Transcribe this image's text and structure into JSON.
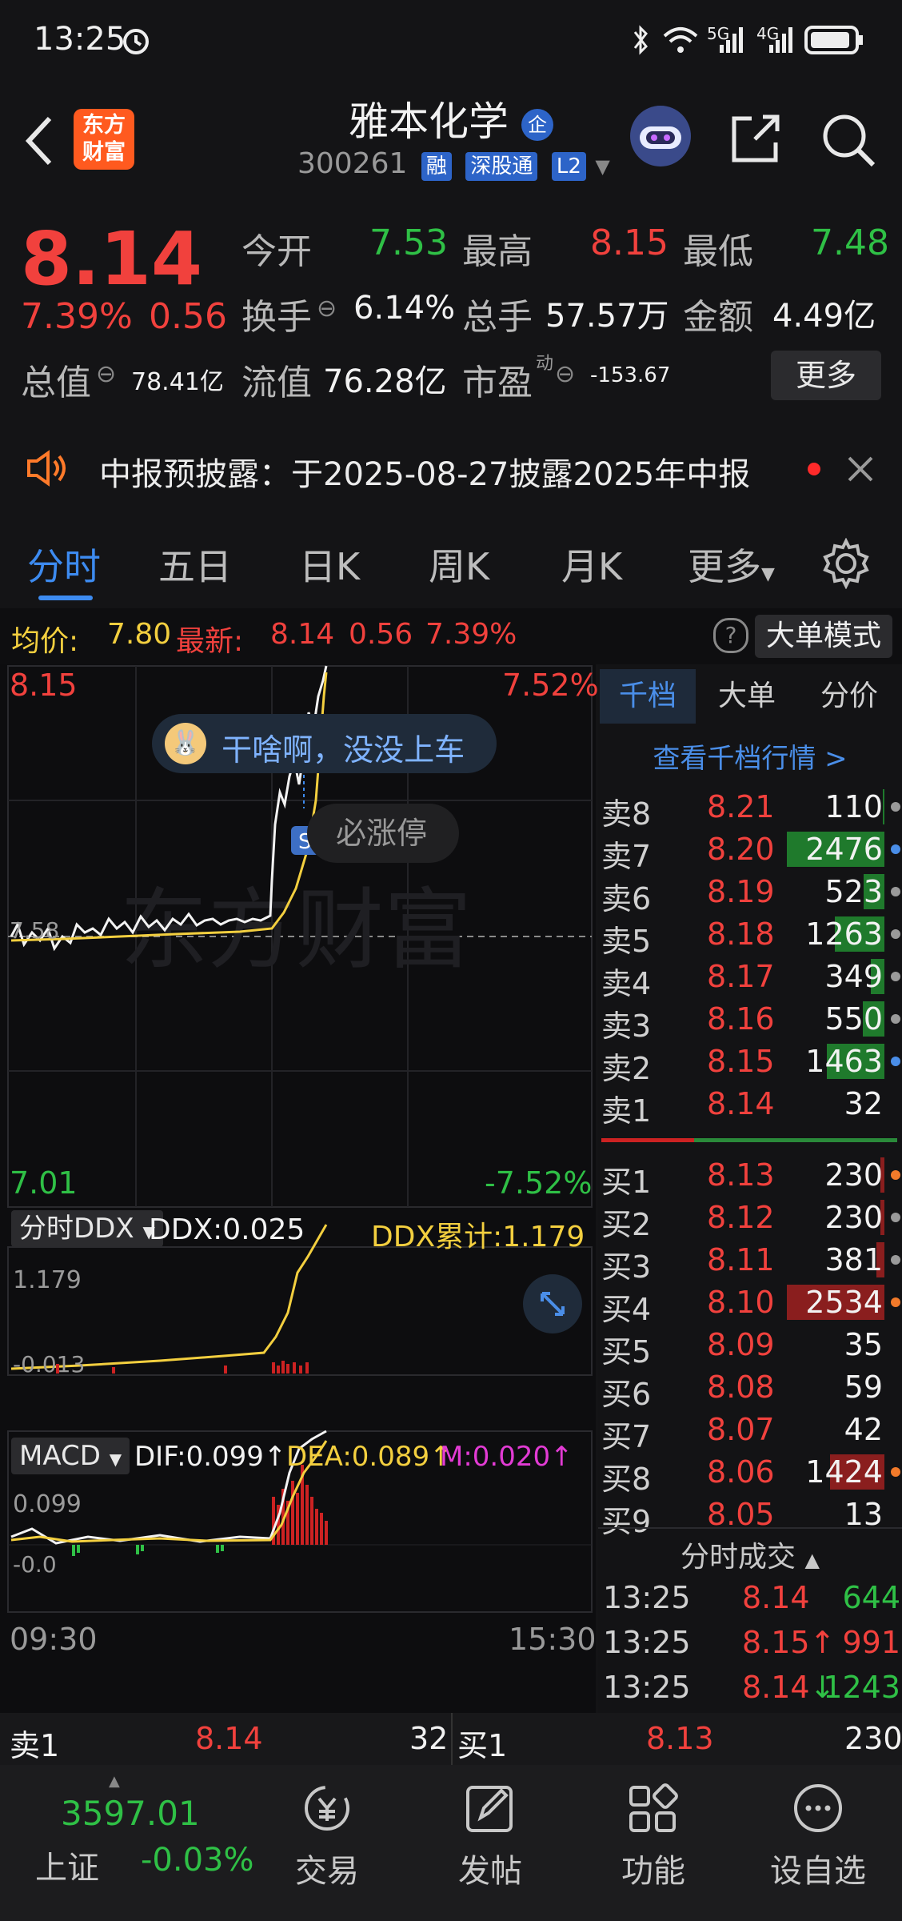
{
  "status_bar": {
    "time": "13:25",
    "signal_5g": "5G",
    "signal_4g": "4G"
  },
  "header": {
    "logo_line1": "东方",
    "logo_line2": "财富",
    "stock_name": "雅本化学",
    "name_badge": "企",
    "stock_code": "300261",
    "badges": [
      "融",
      "深股通",
      "L2"
    ]
  },
  "quote": {
    "price": "8.14",
    "change_pct": "7.39%",
    "change_abs": "0.56",
    "open_label": "今开",
    "open_value": "7.53",
    "high_label": "最高",
    "high_value": "8.15",
    "low_label": "最低",
    "low_value": "7.48",
    "turnover_label": "换手",
    "turnover_value": "6.14%",
    "volume_label": "总手",
    "volume_value": "57.57万",
    "amount_label": "金额",
    "amount_value": "4.49亿",
    "mktcap_label": "总值",
    "mktcap_value": "78.41亿",
    "float_label": "流值",
    "float_value": "76.28亿",
    "pe_label": "市盈",
    "pe_sup": "动",
    "pe_value": "-153.67",
    "more_button": "更多"
  },
  "notice": {
    "text": "中报预披露：于2025-08-27披露2025年中报"
  },
  "tabs": [
    "分时",
    "五日",
    "日K",
    "周K",
    "月K",
    "更多"
  ],
  "avg_bar": {
    "avg_label": "均价:",
    "avg_value": "7.80",
    "latest_label": "最新:",
    "latest_value": "8.14",
    "latest_change": "0.56",
    "latest_pct": "7.39%",
    "big_order_button": "大单模式"
  },
  "chart": {
    "price_high": "8.15",
    "pct_high": "7.52%",
    "price_low": "7.01",
    "pct_low": "-7.52%",
    "mid_price": "7.58",
    "bubble1": "干啥啊，没没上车",
    "bubble2": "必涨停",
    "watermark": "东方财富",
    "time_start": "09:30",
    "time_end": "15:30"
  },
  "ddx": {
    "selector": "分时DDX",
    "ddx_label": "DDX:0.025",
    "ddx_total": "DDX累计:1.179",
    "axis_top": "1.179",
    "axis_low": "-0.013"
  },
  "macd": {
    "selector": "MACD",
    "dif": "DIF:0.099",
    "dea": "DEA:0.089",
    "m": "M:0.020",
    "axis_top": "0.099",
    "axis_low": "-0.0"
  },
  "order_book": {
    "tabs": [
      "千档",
      "大单",
      "分价"
    ],
    "view_link": "查看千档行情 >",
    "asks": [
      {
        "label": "卖8",
        "price": "8.21",
        "vol": "110",
        "bar": 0.02,
        "dot": "#9a9a9a"
      },
      {
        "label": "卖7",
        "price": "8.20",
        "vol": "2476",
        "bar": 1.0,
        "dot": "#4a8ee8"
      },
      {
        "label": "卖6",
        "price": "8.19",
        "vol": "523",
        "bar": 0.21,
        "dot": "#9a9a9a"
      },
      {
        "label": "卖5",
        "price": "8.18",
        "vol": "1263",
        "bar": 0.51,
        "dot": "#9a9a9a"
      },
      {
        "label": "卖4",
        "price": "8.17",
        "vol": "349",
        "bar": 0.14,
        "dot": "#9a9a9a"
      },
      {
        "label": "卖3",
        "price": "8.16",
        "vol": "550",
        "bar": 0.22,
        "dot": "#9a9a9a"
      },
      {
        "label": "卖2",
        "price": "8.15",
        "vol": "1463",
        "bar": 0.59,
        "dot": "#4a8ee8"
      },
      {
        "label": "卖1",
        "price": "8.14",
        "vol": "32",
        "bar": 0.0,
        "dot": ""
      }
    ],
    "bids": [
      {
        "label": "买1",
        "price": "8.13",
        "vol": "230",
        "bar": 0.04,
        "dot": "#f27a2a"
      },
      {
        "label": "买2",
        "price": "8.12",
        "vol": "230",
        "bar": 0.04,
        "dot": "#9a9a9a"
      },
      {
        "label": "买3",
        "price": "8.11",
        "vol": "381",
        "bar": 0.08,
        "dot": "#9a9a9a"
      },
      {
        "label": "买4",
        "price": "8.10",
        "vol": "2534",
        "bar": 1.0,
        "dot": "#f27a2a"
      },
      {
        "label": "买5",
        "price": "8.09",
        "vol": "35",
        "bar": 0.0,
        "dot": ""
      },
      {
        "label": "买6",
        "price": "8.08",
        "vol": "59",
        "bar": 0.0,
        "dot": ""
      },
      {
        "label": "买7",
        "price": "8.07",
        "vol": "42",
        "bar": 0.0,
        "dot": ""
      },
      {
        "label": "买8",
        "price": "8.06",
        "vol": "1424",
        "bar": 0.56,
        "dot": "#f27a2a"
      },
      {
        "label": "买9",
        "price": "8.05",
        "vol": "13",
        "bar": 0.0,
        "dot": ""
      }
    ],
    "trades_title": "分时成交",
    "trades": [
      {
        "time": "13:25",
        "price": "8.14",
        "arrow": "",
        "vol": "644",
        "vol_color": "#2fc046"
      },
      {
        "time": "13:25",
        "price": "8.15",
        "arrow": "↑",
        "vol": "991",
        "vol_color": "#f1413d"
      },
      {
        "time": "13:25",
        "price": "8.14",
        "arrow": "↓",
        "vol": "1243",
        "vol_color": "#2fc046"
      }
    ]
  },
  "bottom_quote": {
    "ask_label": "卖1",
    "ask_price": "8.14",
    "ask_vol": "32",
    "bid_label": "买1",
    "bid_price": "8.13",
    "bid_vol": "230"
  },
  "nav": {
    "index_value": "3597.01",
    "index_name": "上证",
    "index_change": "-0.03%",
    "items": [
      "交易",
      "发帖",
      "功能",
      "设自选"
    ]
  }
}
